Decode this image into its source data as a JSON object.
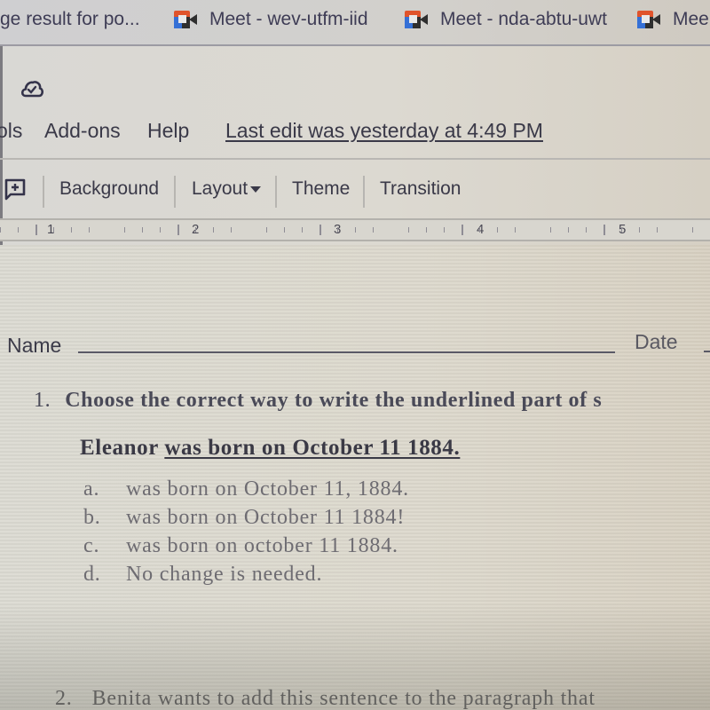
{
  "bookmarks": [
    {
      "label": "ge result for po...",
      "icon": "none"
    },
    {
      "label": "Meet - wev-utfm-iid",
      "icon": "google-meet-icon"
    },
    {
      "label": "Meet - nda-abtu-uwt",
      "icon": "google-meet-icon"
    },
    {
      "label": "Mee",
      "icon": "google-meet-icon"
    }
  ],
  "doc_status": {
    "icon": "cloud-saved-icon"
  },
  "menu": {
    "items": [
      "ols",
      "Add-ons",
      "Help"
    ],
    "last_edit": "Last edit was yesterday at 4:49 PM"
  },
  "toolbar": {
    "comment_icon": "add-comment-icon",
    "background": "Background",
    "layout": "Layout",
    "theme": "Theme",
    "transition": "Transition"
  },
  "ruler": {
    "labels": [
      "1",
      "2",
      "3",
      "4",
      "5"
    ]
  },
  "document": {
    "name_label": "Name",
    "date_label": "Date",
    "question1": {
      "number": "1.",
      "prompt": "Choose the correct way to write the underlined part of s",
      "sentence_plain": "Eleanor ",
      "sentence_underlined": "was born on October 11 1884.",
      "choices": [
        {
          "letter": "a.",
          "text": "was born on October 11, 1884."
        },
        {
          "letter": "b.",
          "text": "was born on October 11 1884!"
        },
        {
          "letter": "c.",
          "text": "was born on october 11 1884."
        },
        {
          "letter": "d.",
          "text": "No change is needed."
        }
      ]
    },
    "question2": {
      "number": "2.",
      "prompt": "Benita wants to add this sentence to the paragraph that"
    }
  }
}
